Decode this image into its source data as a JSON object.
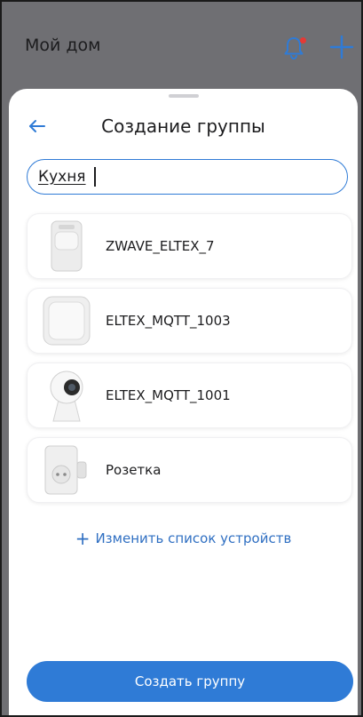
{
  "header": {
    "title": "Мой дом",
    "bell_icon": "bell-icon",
    "add_icon": "plus-icon",
    "accent": "#2f7bd6",
    "notification_dot_color": "#e53935"
  },
  "sheet": {
    "title": "Создание группы",
    "back_icon": "arrow-left-icon",
    "group_name_value": "Кухня",
    "devices": [
      {
        "name": "ZWAVE_ELTEX_7",
        "icon": "motion-sensor-image"
      },
      {
        "name": "ELTEX_MQTT_1003",
        "icon": "wall-switch-image"
      },
      {
        "name": "ELTEX_MQTT_1001",
        "icon": "camera-image"
      },
      {
        "name": "Розетка",
        "icon": "smart-plug-image"
      }
    ],
    "edit_devices_label": "Изменить список устройств",
    "create_button_label": "Создать группу"
  }
}
